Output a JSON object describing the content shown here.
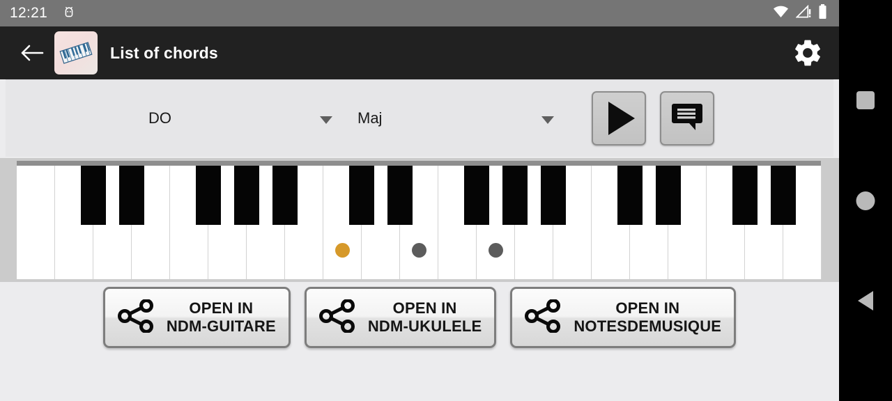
{
  "status_bar": {
    "time": "12:21",
    "icons": [
      "android-head-icon",
      "wifi-icon",
      "cellular-signal-warning-icon",
      "battery-icon"
    ]
  },
  "app_bar": {
    "back_icon": "back-arrow-icon",
    "app_icon": "piano-keyboard-app-icon",
    "title": "List of chords",
    "settings_icon": "gear-icon"
  },
  "chord_bar": {
    "note_spinner": {
      "value": "DO",
      "caret_icon": "chevron-down-icon"
    },
    "type_spinner": {
      "value": "Maj",
      "caret_icon": "chevron-down-icon"
    },
    "play_button": {
      "icon": "play-icon"
    },
    "chat_button": {
      "icon": "comment-bubble-icon"
    }
  },
  "piano": {
    "white_key_count": 21,
    "white_key_width": 55,
    "black_key_offsets": [
      2,
      3,
      5,
      6,
      7,
      9,
      10,
      12,
      13,
      14,
      16,
      17,
      19,
      20
    ],
    "marked_notes": [
      {
        "white_index": 8,
        "color": "#d6992a",
        "label": "DO"
      },
      {
        "white_index": 10,
        "color": "#5c5c5c",
        "label": "MI"
      },
      {
        "white_index": 12,
        "color": "#5c5c5c",
        "label": "SOL"
      }
    ]
  },
  "open_buttons": [
    {
      "icon": "share-icon",
      "label": "OPEN IN\nNDM-GUITARE"
    },
    {
      "icon": "share-icon",
      "label": "OPEN IN\nNDM-UKULELE"
    },
    {
      "icon": "share-icon",
      "label": "OPEN IN\nNOTESDEMUSIQUE"
    }
  ],
  "nav_bar": {
    "recents_icon": "square-recents-icon",
    "home_icon": "circle-home-icon",
    "back_icon": "triangle-back-icon"
  },
  "colors": {
    "status_bar": "#757575",
    "app_bar": "#212121",
    "chord_bar": "#e6e6e8",
    "page_bg": "#ececee",
    "accent_note": "#d6992a",
    "inactive_note": "#5c5c5c"
  }
}
